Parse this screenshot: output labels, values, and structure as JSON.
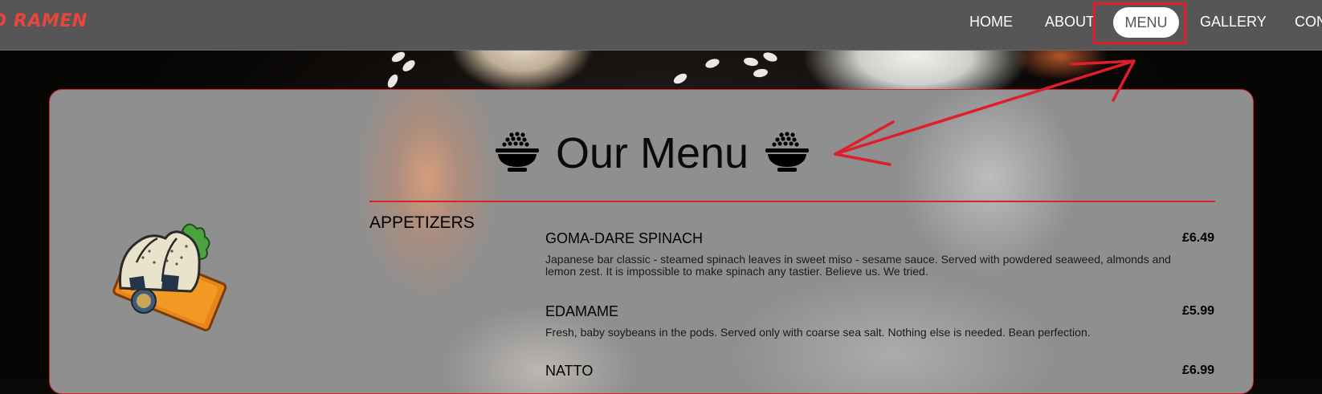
{
  "header": {
    "logo": "D RAMEN",
    "nav": {
      "home": "HOME",
      "about": "ABOUT",
      "menu": "MENU",
      "gallery": "GALLERY",
      "contact": "CON"
    }
  },
  "menu_card": {
    "title": "Our Menu",
    "section": "APPETIZERS",
    "items": [
      {
        "name": "GOMA-DARE SPINACH",
        "price": "£6.49",
        "description": "Japanese bar classic - steamed spinach leaves in sweet miso - sesame sauce. Served with powdered seaweed, almonds and lemon zest. It is impossible to make spinach any tastier. Believe us. We tried."
      },
      {
        "name": "EDAMAME",
        "price": "£5.99",
        "description": "Fresh, baby soybeans in the pods. Served only with coarse sea salt. Nothing else is needed. Bean perfection."
      },
      {
        "name": "NATTO",
        "price": "£6.99",
        "description": ""
      }
    ]
  },
  "colors": {
    "accent_red": "#d4242d",
    "nav_bg": "#565656",
    "logo_red": "#e8453c"
  },
  "icons": [
    "rice-bowl-icon",
    "onigiri-plate-illustration"
  ]
}
